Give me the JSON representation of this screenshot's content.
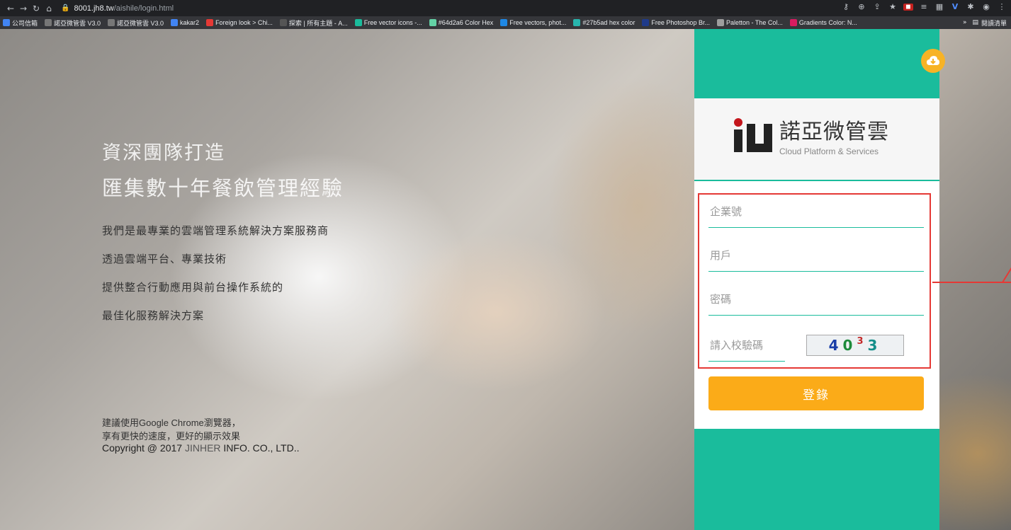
{
  "browser": {
    "url_host": "8001.jh8.tw",
    "url_path": "/aishile/login.html",
    "bookmarks": [
      {
        "label": "公司信箱",
        "color": "#4285f4"
      },
      {
        "label": "諾亞微管雲 V3.0",
        "color": "#777777"
      },
      {
        "label": "諾亞微管雲 V3.0",
        "color": "#777777"
      },
      {
        "label": "kakar2",
        "color": "#4285f4"
      },
      {
        "label": "Foreign look > Chi...",
        "color": "#e53935"
      },
      {
        "label": "探索 | 所有主題 - A...",
        "color": "#555555"
      },
      {
        "label": "Free vector icons -...",
        "color": "#1abc9c"
      },
      {
        "label": "#64d2a6 Color Hex",
        "color": "#64d2a6"
      },
      {
        "label": "Free vectors, phot...",
        "color": "#1e88e5"
      },
      {
        "label": "#27b5ad hex color",
        "color": "#27b5ad"
      },
      {
        "label": "Free Photoshop Br...",
        "color": "#1e3a8a"
      },
      {
        "label": "Paletton - The Col...",
        "color": "#9e9e9e"
      },
      {
        "label": "Gradients Color: N...",
        "color": "#d81b60"
      }
    ],
    "reading_list": "閱讀清單"
  },
  "hero": {
    "title_line1": "資深團隊打造",
    "title_line2": "匯集數十年餐飲管理經驗",
    "desc": [
      "我們是最專業的雲端管理系統解決方案服務商",
      "透過雲端平台、專業技術",
      "提供整合行動應用與前台操作系統的",
      "最佳化服務解決方案"
    ],
    "foot_line1": "建議使用Google Chrome瀏覽器，",
    "foot_line2": "享有更快的速度，更好的顯示效果",
    "copyright_prefix": "Copyright @ 2017 ",
    "copyright_brand": "JINHER",
    "copyright_suffix": " INFO. CO., LTD.."
  },
  "login": {
    "logo_cn": "諾亞微管雲",
    "logo_en": "Cloud Platform & Services",
    "company_placeholder": "企業號",
    "user_placeholder": "用戶",
    "password_placeholder": "密碼",
    "captcha_placeholder": "請入校驗碼",
    "captcha_text": [
      "4",
      "0",
      "3",
      "3"
    ],
    "login_label": "登錄"
  },
  "colors": {
    "teal": "#1abc9c",
    "orange": "#fbab18",
    "highlight_red": "#e53935"
  }
}
